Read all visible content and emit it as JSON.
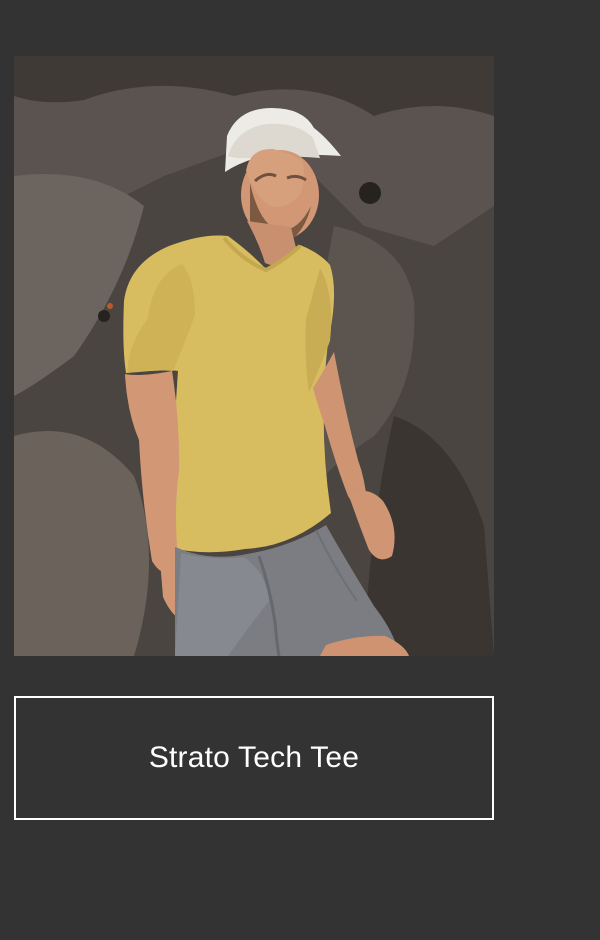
{
  "product": {
    "image_label": "man-in-yellow-tee-on-rocks",
    "title": "Strato Tech Tee"
  },
  "colors": {
    "background": "#333333",
    "rock": "#4a4440",
    "rock_shadow": "#2c2825",
    "tee": "#d8bf63",
    "shorts": "#7d7f83",
    "skin": "#d49a79",
    "cap": "#ecebe6",
    "border": "#ffffff",
    "text": "#ffffff"
  }
}
